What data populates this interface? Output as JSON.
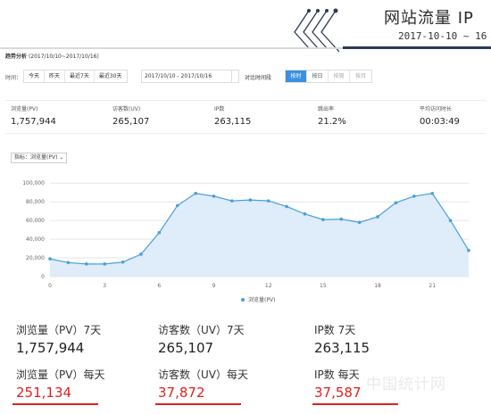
{
  "banner": {
    "title": "网站流量 IP",
    "date_range": "2017-10-10 ~ 16"
  },
  "panel": {
    "title": "趋势分析",
    "title_range": "(2017/10/10~2017/10/16)",
    "time_label": "时间：",
    "quick_ranges": [
      "今天",
      "昨天",
      "最近7天",
      "最近30天"
    ],
    "date_input": "2017/10/10 - 2017/10/16",
    "compare_label": "对比时间段",
    "granularity": [
      "按时",
      "按日",
      "按周",
      "按月"
    ],
    "granularity_active": "按时",
    "metric_select": "指标：浏览量(PV)"
  },
  "metrics": [
    {
      "label": "浏览量(PV)",
      "value": "1,757,944"
    },
    {
      "label": "访客数(UV)",
      "value": "265,107"
    },
    {
      "label": "IP数",
      "value": "263,115"
    },
    {
      "label": "跳出率",
      "value": "21.2%"
    },
    {
      "label": "平均访问时长",
      "value": "00:03:49"
    }
  ],
  "chart_data": {
    "type": "area",
    "x": [
      0,
      1,
      2,
      3,
      4,
      5,
      6,
      7,
      8,
      9,
      10,
      11,
      12,
      13,
      14,
      15,
      16,
      17,
      18,
      19,
      20,
      21,
      22,
      23
    ],
    "x_ticks": [
      "0",
      "3",
      "6",
      "9",
      "12",
      "15",
      "18",
      "21"
    ],
    "y_ticks": [
      "0",
      "20,000",
      "40,000",
      "60,000",
      "80,000",
      "100,000"
    ],
    "ylim": [
      0,
      105000
    ],
    "series": [
      {
        "name": "浏览量(PV)",
        "values": [
          19000,
          15000,
          13500,
          13500,
          15500,
          24000,
          47000,
          76000,
          89000,
          86000,
          81000,
          82000,
          81000,
          75000,
          67000,
          61000,
          61500,
          58000,
          64000,
          79000,
          86000,
          89000,
          60000,
          28000
        ],
        "color": "#4a9fd8"
      }
    ],
    "grid": true,
    "legend": "bottom"
  },
  "summary": {
    "weekly": [
      {
        "label": "浏览量（PV）7天",
        "value": "1,757,944"
      },
      {
        "label": "访客数（UV）7天",
        "value": "265,107"
      },
      {
        "label": "IP数 7天",
        "value": "263,115"
      }
    ],
    "daily": [
      {
        "label": "浏览量（PV）每天",
        "value": "251,134"
      },
      {
        "label": "访客数（UV）每天",
        "value": "37,872"
      },
      {
        "label": "IP数 每天",
        "value": "37,587"
      }
    ],
    "highlight_color": "#e02020"
  },
  "watermark": "中国统计网"
}
